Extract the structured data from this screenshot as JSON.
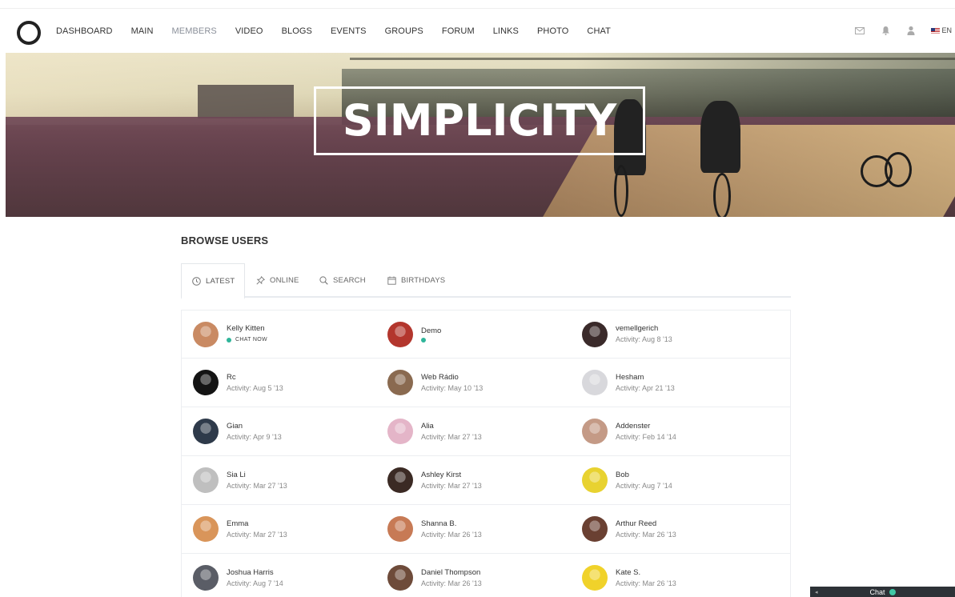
{
  "nav": {
    "items": [
      {
        "label": "DASHBOARD",
        "active": false
      },
      {
        "label": "MAIN",
        "active": false
      },
      {
        "label": "MEMBERS",
        "active": true
      },
      {
        "label": "VIDEO",
        "active": false
      },
      {
        "label": "BLOGS",
        "active": false
      },
      {
        "label": "EVENTS",
        "active": false
      },
      {
        "label": "GROUPS",
        "active": false
      },
      {
        "label": "FORUM",
        "active": false
      },
      {
        "label": "LINKS",
        "active": false
      },
      {
        "label": "PHOTO",
        "active": false
      },
      {
        "label": "CHAT",
        "active": false
      }
    ],
    "icons": [
      "mail-icon",
      "bell-icon",
      "user-icon"
    ],
    "language": "EN"
  },
  "hero": {
    "title": "SIMPLICITY"
  },
  "page": {
    "title": "BROWSE USERS"
  },
  "tabs": [
    {
      "label": "LATEST",
      "icon": "clock-icon",
      "active": true
    },
    {
      "label": "ONLINE",
      "icon": "pin-icon",
      "active": false
    },
    {
      "label": "SEARCH",
      "icon": "search-icon",
      "active": false
    },
    {
      "label": "BIRTHDAYS",
      "icon": "calendar-icon",
      "active": false
    }
  ],
  "users": [
    {
      "name": "Kelly Kitten",
      "status": "CHAT NOW",
      "online": true,
      "avatar_color": "#c98a63"
    },
    {
      "name": "Demo",
      "status": "",
      "online": true,
      "avatar_color": "#b3362d"
    },
    {
      "name": "vemellgerich",
      "status": "Activity: Aug 8 '13",
      "online": false,
      "avatar_color": "#3a2a2a"
    },
    {
      "name": "Rc",
      "status": "Activity: Aug 5 '13",
      "online": false,
      "avatar_color": "#141414"
    },
    {
      "name": "Web Rádio",
      "status": "Activity: May 10 '13",
      "online": false,
      "avatar_color": "#8a6a50"
    },
    {
      "name": "Hesham",
      "status": "Activity: Apr 21 '13",
      "online": false,
      "avatar_color": "#d8d8dc"
    },
    {
      "name": "Gian",
      "status": "Activity: Apr 9 '13",
      "online": false,
      "avatar_color": "#2e3a4a"
    },
    {
      "name": "Alia",
      "status": "Activity: Mar 27 '13",
      "online": false,
      "avatar_color": "#e4b5c8"
    },
    {
      "name": "Addenster",
      "status": "Activity: Feb 14 '14",
      "online": false,
      "avatar_color": "#c49a86"
    },
    {
      "name": "Sia Li",
      "status": "Activity: Mar 27 '13",
      "online": false,
      "avatar_color": "#bfbfbf"
    },
    {
      "name": "Ashley Kirst",
      "status": "Activity: Mar 27 '13",
      "online": false,
      "avatar_color": "#3b2a24"
    },
    {
      "name": "Bob",
      "status": "Activity: Aug 7 '14",
      "online": false,
      "avatar_color": "#e8d230"
    },
    {
      "name": "Emma",
      "status": "Activity: Mar 27 '13",
      "online": false,
      "avatar_color": "#d9955a"
    },
    {
      "name": "Shanna B.",
      "status": "Activity: Mar 26 '13",
      "online": false,
      "avatar_color": "#c77a55"
    },
    {
      "name": "Arthur Reed",
      "status": "Activity: Mar 26 '13",
      "online": false,
      "avatar_color": "#6a4032"
    },
    {
      "name": "Joshua Harris",
      "status": "Activity: Aug 7 '14",
      "online": false,
      "avatar_color": "#5a5d66"
    },
    {
      "name": "Daniel Thompson",
      "status": "Activity: Mar 26 '13",
      "online": false,
      "avatar_color": "#6e4b3a"
    },
    {
      "name": "Kate S.",
      "status": "Activity: Mar 26 '13",
      "online": false,
      "avatar_color": "#f0d22a"
    }
  ],
  "chatbar": {
    "label": "Chat"
  },
  "colors": {
    "online": "#2fb59a",
    "chatbar_bg": "#2d3237"
  }
}
